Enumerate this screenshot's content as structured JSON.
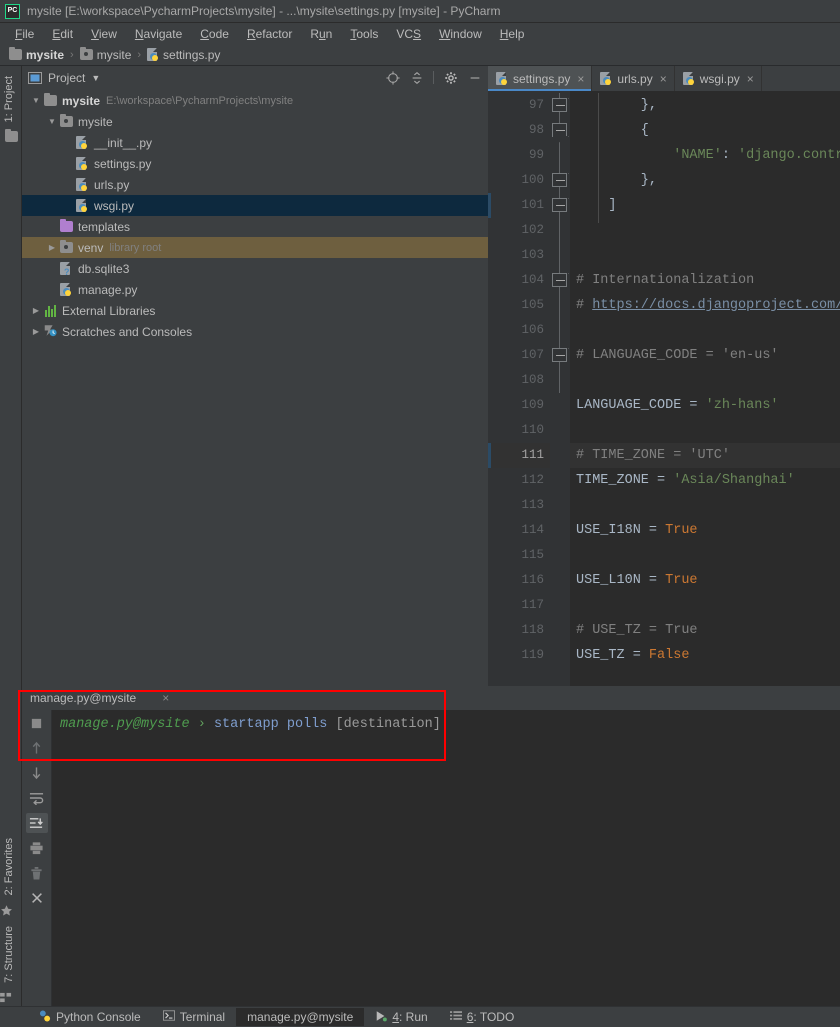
{
  "window": {
    "title": "mysite [E:\\workspace\\PycharmProjects\\mysite] - ...\\mysite\\settings.py [mysite] - PyCharm",
    "logo_text": "PC"
  },
  "menubar": {
    "items": [
      {
        "label": "File",
        "mnemonic": "F"
      },
      {
        "label": "Edit",
        "mnemonic": "E"
      },
      {
        "label": "View",
        "mnemonic": "V"
      },
      {
        "label": "Navigate",
        "mnemonic": "N"
      },
      {
        "label": "Code",
        "mnemonic": "C"
      },
      {
        "label": "Refactor",
        "mnemonic": "R"
      },
      {
        "label": "Run",
        "mnemonic": "u"
      },
      {
        "label": "Tools",
        "mnemonic": "T"
      },
      {
        "label": "VCS",
        "mnemonic": "S"
      },
      {
        "label": "Window",
        "mnemonic": "W"
      },
      {
        "label": "Help",
        "mnemonic": "H"
      }
    ]
  },
  "breadcrumb": {
    "items": [
      {
        "label": "mysite",
        "icon": "folder-icon"
      },
      {
        "label": "mysite",
        "icon": "module-folder-icon"
      },
      {
        "label": "settings.py",
        "icon": "python-file-icon"
      }
    ],
    "separator": "›"
  },
  "left_rail": {
    "top_button": {
      "label": "1: Project",
      "mnemonic": "1"
    },
    "bottom_buttons": [
      {
        "label": "2: Favorites",
        "mnemonic": "2"
      },
      {
        "label": "7: Structure",
        "mnemonic": "7"
      }
    ]
  },
  "project_panel": {
    "title": "Project",
    "dropdown_glyph": "▼",
    "header_icons": [
      {
        "name": "locate-target-icon"
      },
      {
        "name": "collapse-all-icon"
      },
      {
        "name": "settings-gear-icon"
      },
      {
        "name": "hide-panel-icon"
      }
    ],
    "tree": [
      {
        "label": "mysite",
        "sub": "E:\\workspace\\PycharmProjects\\mysite",
        "icon": "folder-icon",
        "arrow": "▼",
        "indent": 0,
        "bold": true,
        "state": "normal"
      },
      {
        "label": "mysite",
        "sub": "",
        "icon": "module-folder-icon",
        "arrow": "▼",
        "indent": 1,
        "bold": false,
        "state": "normal"
      },
      {
        "label": "__init__.py",
        "sub": "",
        "icon": "python-file-icon",
        "arrow": "",
        "indent": 2,
        "bold": false,
        "state": "normal"
      },
      {
        "label": "settings.py",
        "sub": "",
        "icon": "python-file-icon",
        "arrow": "",
        "indent": 2,
        "bold": false,
        "state": "normal"
      },
      {
        "label": "urls.py",
        "sub": "",
        "icon": "python-file-icon",
        "arrow": "",
        "indent": 2,
        "bold": false,
        "state": "normal"
      },
      {
        "label": "wsgi.py",
        "sub": "",
        "icon": "python-file-icon",
        "arrow": "",
        "indent": 2,
        "bold": false,
        "state": "selected"
      },
      {
        "label": "templates",
        "sub": "",
        "icon": "templates-folder-icon",
        "arrow": "",
        "indent": 1,
        "bold": false,
        "state": "normal"
      },
      {
        "label": "venv",
        "sub": "library root",
        "icon": "module-folder-icon",
        "arrow": "▶",
        "indent": 1,
        "bold": false,
        "state": "venv"
      },
      {
        "label": "db.sqlite3",
        "sub": "",
        "icon": "sqlite-file-icon",
        "arrow": "",
        "indent": 1,
        "bold": false,
        "state": "normal"
      },
      {
        "label": "manage.py",
        "sub": "",
        "icon": "python-file-icon",
        "arrow": "",
        "indent": 1,
        "bold": false,
        "state": "normal"
      },
      {
        "label": "External Libraries",
        "sub": "",
        "icon": "libraries-icon",
        "arrow": "▶",
        "indent": 0,
        "bold": false,
        "state": "normal"
      },
      {
        "label": "Scratches and Consoles",
        "sub": "",
        "icon": "scratches-icon",
        "arrow": "▶",
        "indent": 0,
        "bold": false,
        "state": "normal"
      }
    ]
  },
  "editor": {
    "tabs": [
      {
        "label": "settings.py",
        "active": true,
        "icon": "python-file-icon",
        "close": "×"
      },
      {
        "label": "urls.py",
        "active": false,
        "icon": "python-file-icon",
        "close": "×"
      },
      {
        "label": "wsgi.py",
        "active": false,
        "icon": "python-file-icon",
        "close": "×"
      }
    ],
    "current_line": 111,
    "lines": [
      {
        "num": 97,
        "fold": "up",
        "segments": [
          {
            "t": "        },",
            "c": "p"
          }
        ]
      },
      {
        "num": 98,
        "fold": "down",
        "segments": [
          {
            "t": "        {",
            "c": "p"
          }
        ]
      },
      {
        "num": 99,
        "fold": "",
        "segments": [
          {
            "t": "            ",
            "c": "p"
          },
          {
            "t": "'NAME'",
            "c": "str"
          },
          {
            "t": ": ",
            "c": "p"
          },
          {
            "t": "'django.contrib.a",
            "c": "str"
          }
        ]
      },
      {
        "num": 100,
        "fold": "up",
        "segments": [
          {
            "t": "        },",
            "c": "p"
          }
        ]
      },
      {
        "num": 101,
        "fold": "up",
        "segments": [
          {
            "t": "    ]",
            "c": "p"
          }
        ]
      },
      {
        "num": 102,
        "fold": "",
        "segments": []
      },
      {
        "num": 103,
        "fold": "",
        "segments": []
      },
      {
        "num": 104,
        "fold": "up",
        "segments": [
          {
            "t": "# Internationalization",
            "c": "cmt"
          }
        ]
      },
      {
        "num": 105,
        "fold": "",
        "segments": [
          {
            "t": "# ",
            "c": "cmt"
          },
          {
            "t": "https://docs.djangoproject.com/",
            "c": "link"
          }
        ]
      },
      {
        "num": 106,
        "fold": "",
        "segments": []
      },
      {
        "num": 107,
        "fold": "up",
        "segments": [
          {
            "t": "# LANGUAGE_CODE = 'en-us'",
            "c": "cmt"
          }
        ]
      },
      {
        "num": 108,
        "fold": "",
        "segments": []
      },
      {
        "num": 109,
        "fold": "",
        "segments": [
          {
            "t": "LANGUAGE_CODE = ",
            "c": "p"
          },
          {
            "t": "'zh-hans'",
            "c": "str"
          }
        ]
      },
      {
        "num": 110,
        "fold": "",
        "segments": []
      },
      {
        "num": 111,
        "fold": "",
        "segments": [
          {
            "t": "# TIME_ZONE = 'UTC'",
            "c": "cmt"
          }
        ]
      },
      {
        "num": 112,
        "fold": "",
        "segments": [
          {
            "t": "TIME_ZONE = ",
            "c": "p"
          },
          {
            "t": "'Asia/Shanghai'",
            "c": "str"
          }
        ]
      },
      {
        "num": 113,
        "fold": "",
        "segments": []
      },
      {
        "num": 114,
        "fold": "",
        "segments": [
          {
            "t": "USE_I18N = ",
            "c": "p"
          },
          {
            "t": "True",
            "c": "kw"
          }
        ]
      },
      {
        "num": 115,
        "fold": "",
        "segments": []
      },
      {
        "num": 116,
        "fold": "",
        "segments": [
          {
            "t": "USE_L10N = ",
            "c": "p"
          },
          {
            "t": "True",
            "c": "kw"
          }
        ]
      },
      {
        "num": 117,
        "fold": "",
        "segments": []
      },
      {
        "num": 118,
        "fold": "",
        "segments": [
          {
            "t": "# USE_TZ = True",
            "c": "cmt"
          }
        ]
      },
      {
        "num": 119,
        "fold": "",
        "segments": [
          {
            "t": "USE_TZ = ",
            "c": "p"
          },
          {
            "t": "False",
            "c": "kw"
          }
        ]
      }
    ]
  },
  "run_panel": {
    "tab_label": "manage.py@mysite",
    "tab_close": "×",
    "toolbar_icons": [
      {
        "name": "stop-icon",
        "active": false
      },
      {
        "name": "arrow-up-icon",
        "active": false
      },
      {
        "name": "arrow-down-icon",
        "active": false
      },
      {
        "name": "soft-wrap-icon",
        "active": false
      },
      {
        "name": "scroll-to-end-icon",
        "active": true
      },
      {
        "name": "print-icon",
        "active": false
      },
      {
        "name": "trash-icon",
        "active": false
      },
      {
        "name": "close-icon",
        "active": false
      }
    ],
    "console": {
      "prompt": "manage.py@mysite",
      "chevron": "›",
      "command": "startapp polls",
      "hint": "[destination]"
    }
  },
  "statusbar": {
    "items": [
      {
        "label": "Python Console",
        "icon": "python-console-icon",
        "mnemonic": "",
        "active": false
      },
      {
        "label": "Terminal",
        "icon": "terminal-icon",
        "mnemonic": "",
        "active": false
      },
      {
        "label": "manage.py@mysite",
        "icon": "",
        "mnemonic": "",
        "active": true
      },
      {
        "label": "4: Run",
        "icon": "run-icon",
        "mnemonic": "4",
        "active": false
      },
      {
        "label": "6: TODO",
        "icon": "todo-icon",
        "mnemonic": "6",
        "active": false
      }
    ]
  },
  "colors": {
    "chrome": "#3c3f41",
    "editor_bg": "#2b2b2b",
    "gutter_bg": "#313335",
    "selection": "#0d293e",
    "venv_row": "#6e5f3f",
    "accent_tab": "#4a88c7",
    "string": "#6a8759",
    "comment": "#808080",
    "keyword": "#cc7832",
    "highlight_box": "#ff0000"
  }
}
